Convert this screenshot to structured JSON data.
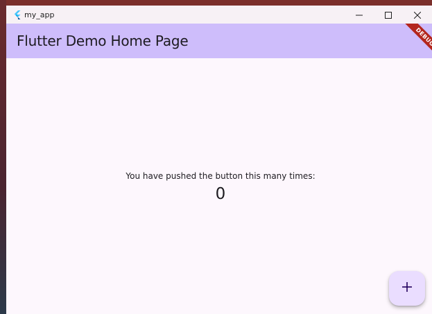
{
  "window": {
    "title": "my_app",
    "controls": {
      "minimize_icon": "minimize-icon",
      "maximize_icon": "maximize-icon",
      "close_icon": "close-icon"
    }
  },
  "appbar": {
    "title": "Flutter Demo Home Page"
  },
  "debug_banner": {
    "label": "DEBUG"
  },
  "body": {
    "counter_label": "You have pushed the button this many times:",
    "counter_value": "0"
  },
  "fab": {
    "icon": "add-icon",
    "label": "+"
  },
  "colors": {
    "appbar": "#cebdfb",
    "background": "#fdf7fd",
    "fab": "#eaddff",
    "debug": "#b3261e"
  }
}
